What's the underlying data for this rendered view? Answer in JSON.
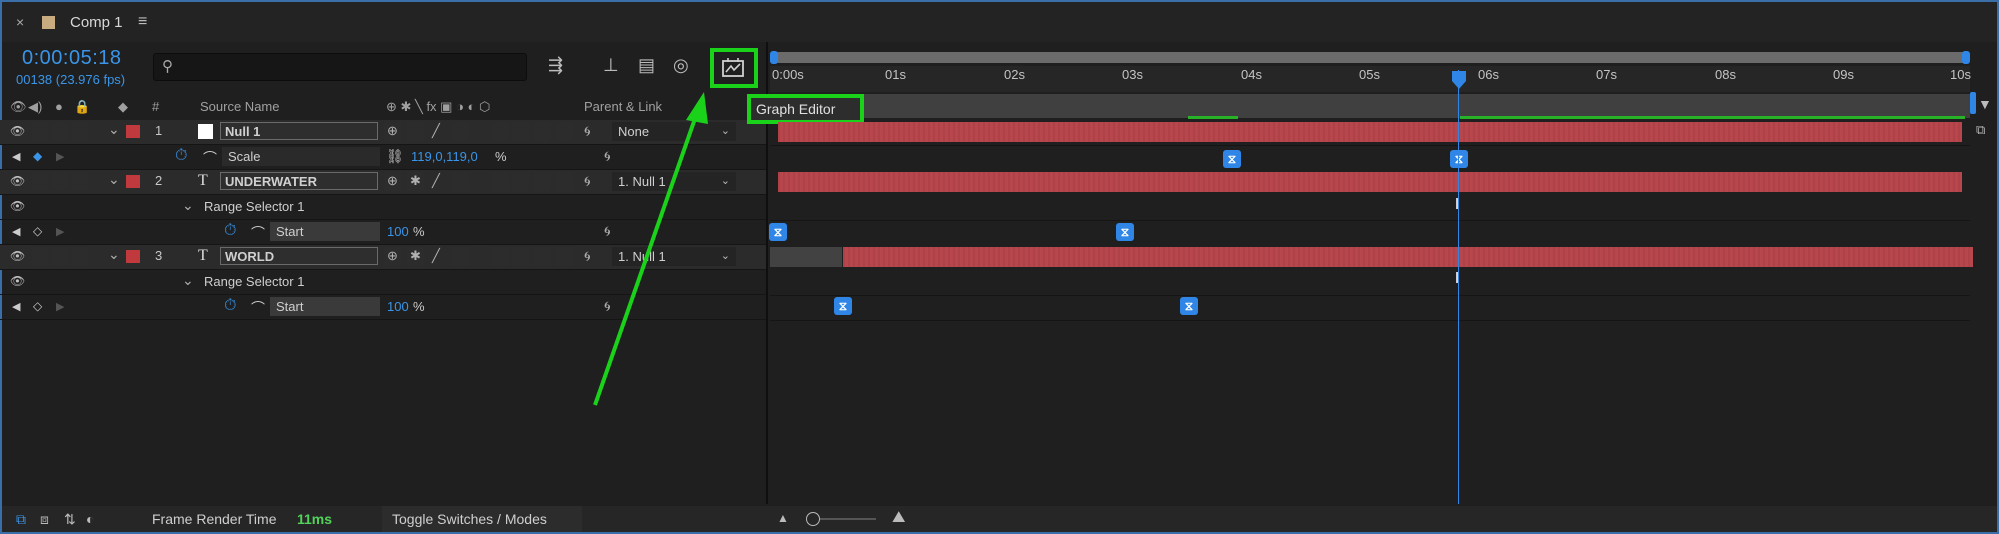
{
  "comp": {
    "tab_close": "×",
    "tab_title": "Comp 1",
    "tab_menu": "≡"
  },
  "header": {
    "timecode": "0:00:05:18",
    "frames": "00138 (23.976 fps)",
    "search_placeholder": ""
  },
  "columns": {
    "source_name": "Source Name",
    "number": "#",
    "parent_link": "Parent & Link"
  },
  "callout": {
    "graph_editor": "Graph Editor"
  },
  "time_ruler": [
    "0:00s",
    "01s",
    "02s",
    "03s",
    "04s",
    "05s",
    "06s",
    "07s",
    "08s",
    "09s",
    "10s"
  ],
  "layers": [
    {
      "number": "1",
      "name": "Null 1",
      "parent": "None",
      "label_color": "#c0393c"
    },
    {
      "number": "2",
      "name": "UNDERWATER",
      "parent": "1. Null 1",
      "label_color": "#c0393c"
    },
    {
      "number": "3",
      "name": "WORLD",
      "parent": "1. Null 1",
      "label_color": "#c0393c"
    }
  ],
  "properties": {
    "scale": {
      "name": "Scale",
      "value": "119,0,119,0",
      "unit": "%"
    },
    "range1": {
      "name": "Range Selector 1"
    },
    "start1": {
      "name": "Start",
      "value": "100",
      "unit": "%"
    },
    "range2": {
      "name": "Range Selector 1"
    },
    "start2": {
      "name": "Start",
      "value": "100",
      "unit": "%"
    }
  },
  "footer": {
    "frame_render_label": "Frame Render Time",
    "frame_render_value": "11ms",
    "toggle_label": "Toggle Switches / Modes"
  },
  "colors": {
    "accent": "#3a95e8",
    "highlight": "#1bd21b",
    "layer_bar": "#b8464d",
    "keyframe": "#2f86e6"
  },
  "icons": [
    "close-icon",
    "menu-icon",
    "search-icon",
    "graph-editor-icon",
    "eye-icon",
    "audio-icon",
    "solo-icon",
    "lock-icon",
    "label-icon",
    "stopwatch-icon",
    "graph-icon",
    "link-icon",
    "spiral-icon",
    "keyframe-icon",
    "current-time-indicator-icon"
  ]
}
